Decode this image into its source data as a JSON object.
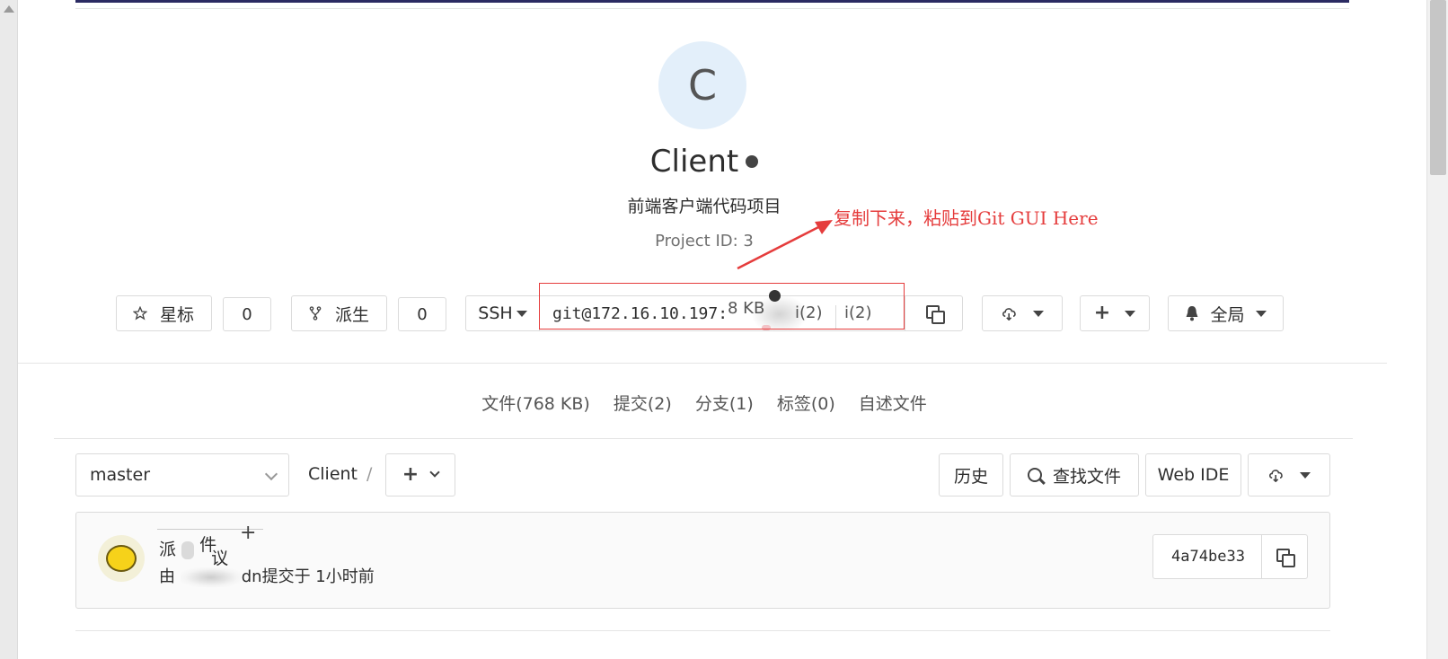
{
  "project": {
    "avatar_letter": "C",
    "name": "Client",
    "description": "前端客户端代码项目",
    "project_id": "Project ID: 3"
  },
  "annotation": {
    "text": "复制下来，粘贴到Git GUI Here",
    "color": "#e53c3c"
  },
  "actions": {
    "star_label": "星标",
    "star_count": "0",
    "fork_label": "派生",
    "fork_count": "0",
    "protocol": "SSH",
    "clone_url": "git@172.16.10.197:",
    "overlay_size": "8 KB",
    "overlay_i1": "i(2)",
    "overlay_i2": "i(2)",
    "notification_label": "全局"
  },
  "stats": {
    "files": "文件(768 KB)",
    "commits": "提交(2)",
    "branches": "分支(1)",
    "tags": "标签(0)",
    "readme": "自述文件"
  },
  "tree": {
    "branch": "master",
    "path": "Client",
    "slash": "/",
    "history_label": "历史",
    "find_file_label": "查找文件",
    "web_ide_label": "Web IDE"
  },
  "commit": {
    "title_a": "派",
    "title_b": "件",
    "title_c": "议",
    "meta_prefix": "由",
    "meta_suffix": "dn提交于 1小时前",
    "sha": "4a74be33"
  },
  "colors": {
    "accent_topbar": "#2b2a62",
    "avatar_bg": "#e3effa"
  }
}
